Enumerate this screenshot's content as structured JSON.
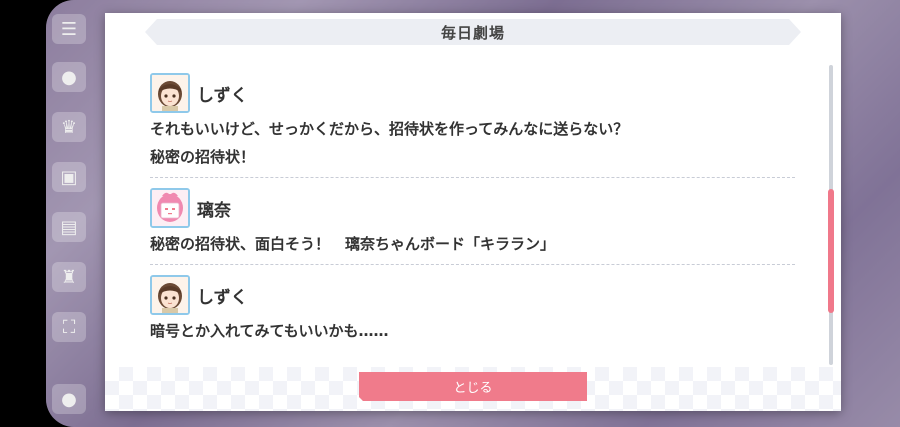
{
  "dialog": {
    "title": "毎日劇場",
    "close_label": "とじる"
  },
  "entries": [
    {
      "speaker": "しずく",
      "avatar": "shizuku-avatar",
      "lines": [
        "それもいいけど、せっかくだから、招待状を作ってみんなに送らない？",
        "秘密の招待状！"
      ]
    },
    {
      "speaker": "璃奈",
      "avatar": "rina-avatar",
      "lines": [
        "秘密の招待状、面白そう！　璃奈ちゃんボード「キララン」"
      ]
    },
    {
      "speaker": "しずく",
      "avatar": "shizuku-avatar",
      "lines": [
        "暗号とか入れてみてもいいかも……"
      ]
    }
  ],
  "colors": {
    "accent": "#f07b8b",
    "avatar_border": "#8fc9ea",
    "title_bar": "#eceef3"
  }
}
